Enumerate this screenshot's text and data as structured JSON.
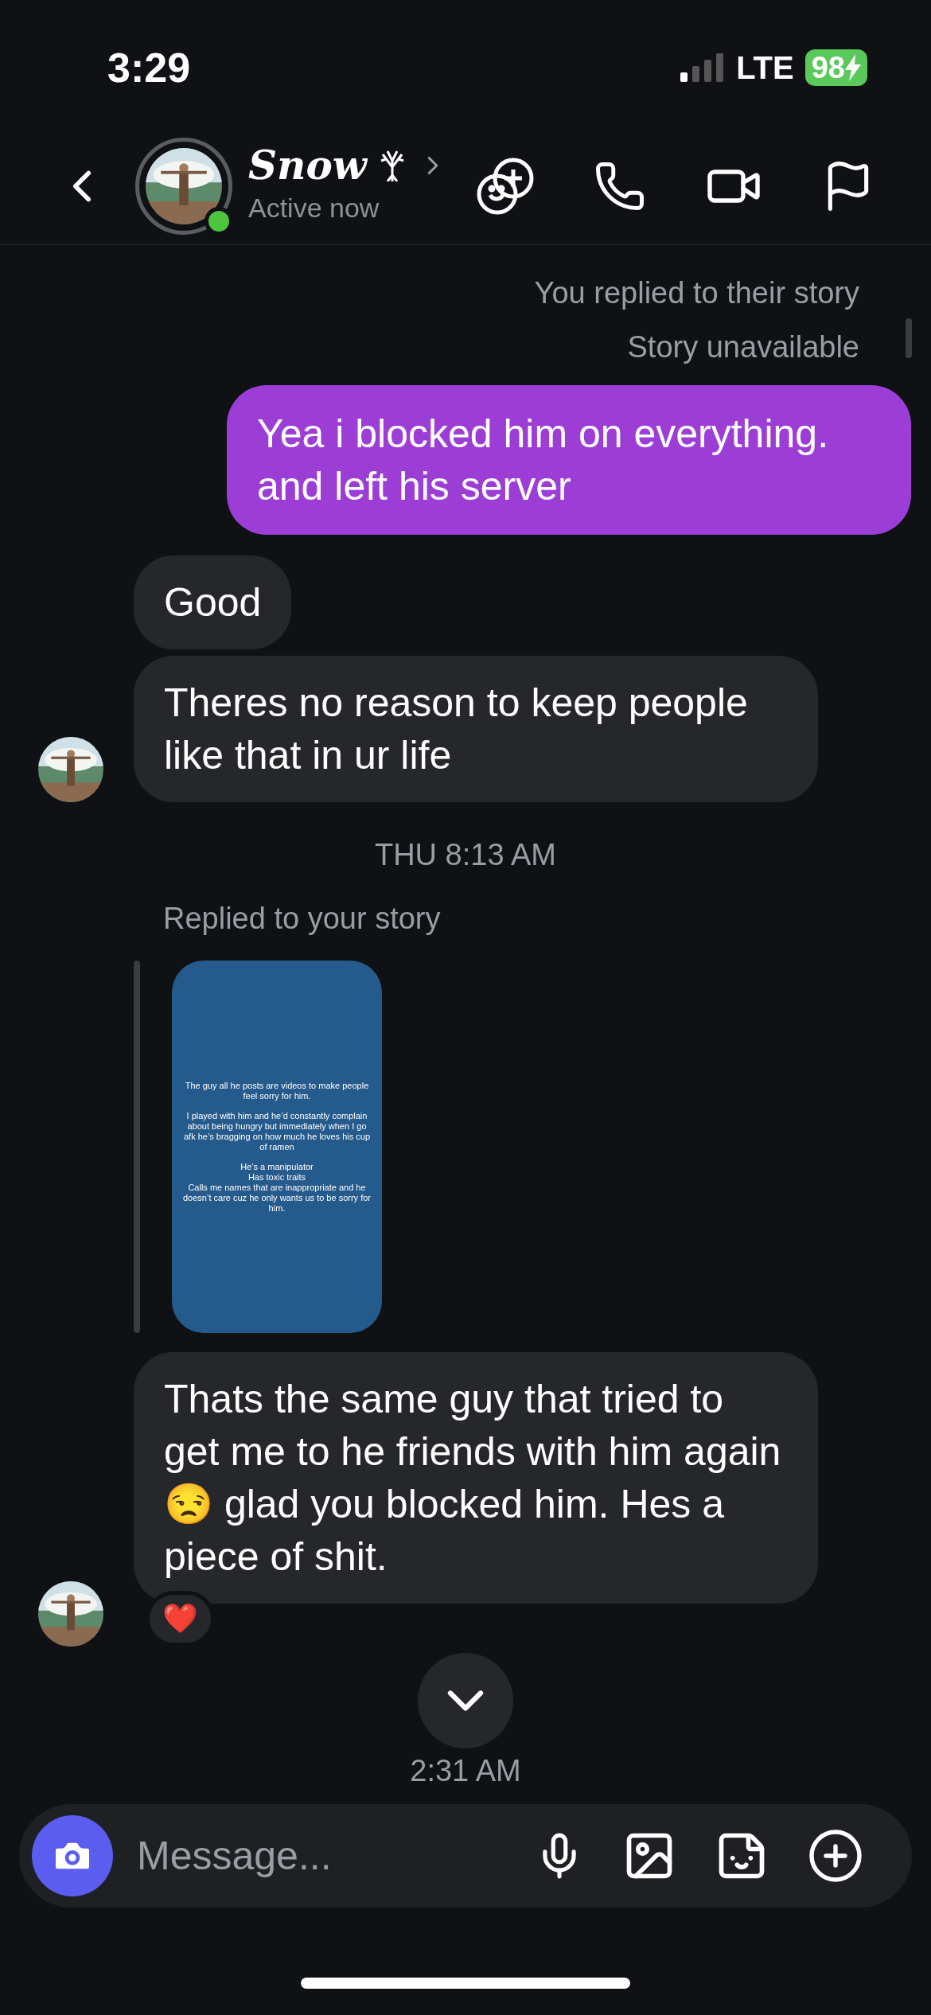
{
  "status_bar": {
    "time": "3:29",
    "network": "LTE",
    "battery": "98",
    "charging": true
  },
  "header": {
    "name": "Snow",
    "status": "Active now",
    "online": true
  },
  "messages": [
    {
      "kind": "note",
      "text": "You replied to their story"
    },
    {
      "kind": "note",
      "text": "Story unavailable"
    },
    {
      "kind": "sent",
      "text": "Yea i blocked him on everything. and left his server"
    },
    {
      "kind": "received",
      "text": "Good",
      "avatar": false
    },
    {
      "kind": "received",
      "text": "Theres no reason to keep people like that in ur life",
      "avatar": true
    },
    {
      "kind": "timestamp",
      "text": "THU 8:13 AM"
    },
    {
      "kind": "story_reply",
      "label": "Replied to your story",
      "story_text": [
        "The guy all he posts are videos to make people feel sorry for him.",
        "I played with him and he’d constantly complain about being hungry but immediately when I go afk he’s bragging on how much he loves his cup of ramen",
        "He’s a manipulator\nHas toxic traits\nCalls me names that are inappropriate and he doesn’t care cuz he only wants us to be sorry for him."
      ]
    },
    {
      "kind": "received",
      "text": "Thats the same guy that tried to get me to he friends with him again 😒 glad you blocked him. Hes a piece of shit.",
      "avatar": true,
      "reaction": "❤️"
    },
    {
      "kind": "timestamp",
      "text": "2:31 AM"
    }
  ],
  "composer": {
    "placeholder": "Message..."
  }
}
